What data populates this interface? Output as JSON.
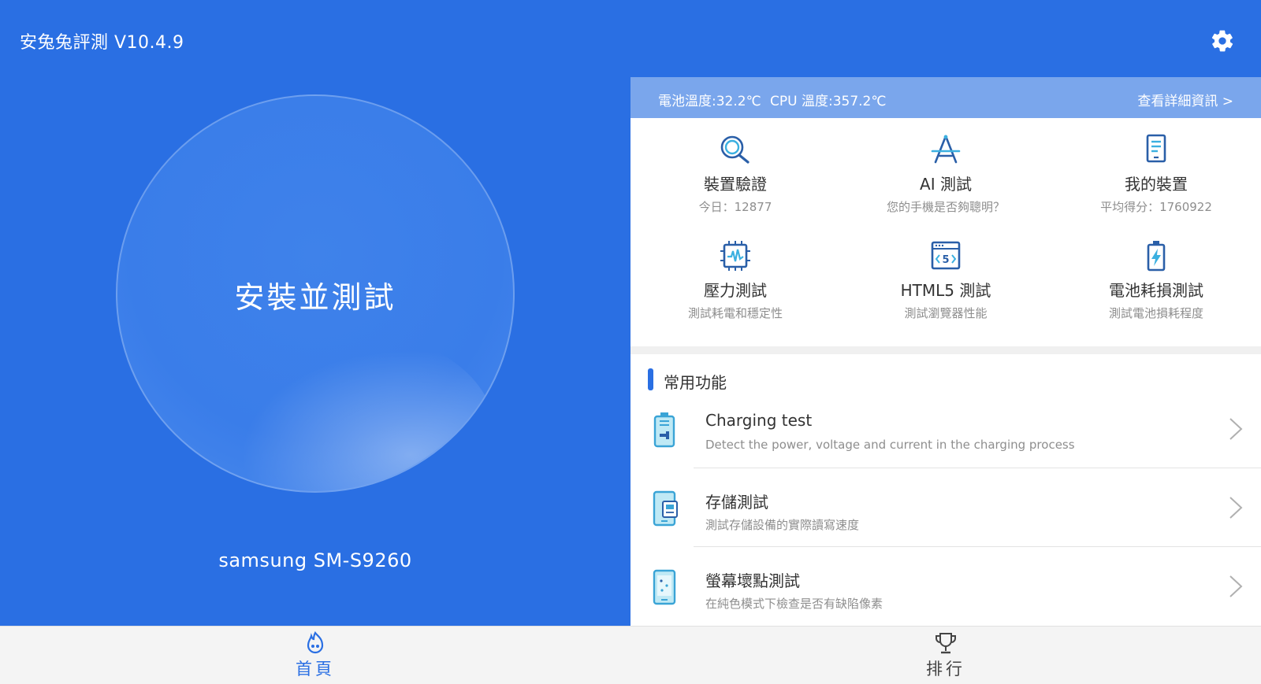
{
  "header": {
    "title": "安兔兔評測 V10.4.9",
    "settings_icon": "gear-icon"
  },
  "main": {
    "test_button_label": "安裝並測試",
    "device_name": "samsung SM-S9260"
  },
  "status": {
    "battery_temp": "電池溫度:32.2℃",
    "cpu_temp": "CPU 溫度:357.2℃",
    "detail_link": "查看詳細資訊 >"
  },
  "features": [
    {
      "icon": "search-icon",
      "title": "裝置驗證",
      "subtitle": "今日：12877"
    },
    {
      "icon": "ai-icon",
      "title": "AI 測試",
      "subtitle": "您的手機是否夠聰明？"
    },
    {
      "icon": "my-device-icon",
      "title": "我的裝置",
      "subtitle": "平均得分：1760922"
    },
    {
      "icon": "stress-chip-icon",
      "title": "壓力測試",
      "subtitle": "測試耗電和穩定性"
    },
    {
      "icon": "html5-icon",
      "title": "HTML5 測試",
      "subtitle": "測試瀏覽器性能"
    },
    {
      "icon": "battery-drain-icon",
      "title": "電池耗損測試",
      "subtitle": "測試電池損耗程度"
    }
  ],
  "common": {
    "section_title": "常用功能",
    "items": [
      {
        "icon": "charging-battery-icon",
        "title": "Charging test",
        "subtitle": "Detect the power, voltage and current in the charging process"
      },
      {
        "icon": "storage-phone-icon",
        "title": "存儲測試",
        "subtitle": "測試存儲設備的實際讀寫速度"
      },
      {
        "icon": "screen-pixel-icon",
        "title": "螢幕壞點測試",
        "subtitle": "在純色模式下檢查是否有缺陷像素"
      }
    ]
  },
  "nav": {
    "home_label": "首頁",
    "rank_label": "排行"
  },
  "colors": {
    "primary": "#2a6fe3",
    "status_bar": "#7aa6ec",
    "background": "#f0f0f0"
  }
}
